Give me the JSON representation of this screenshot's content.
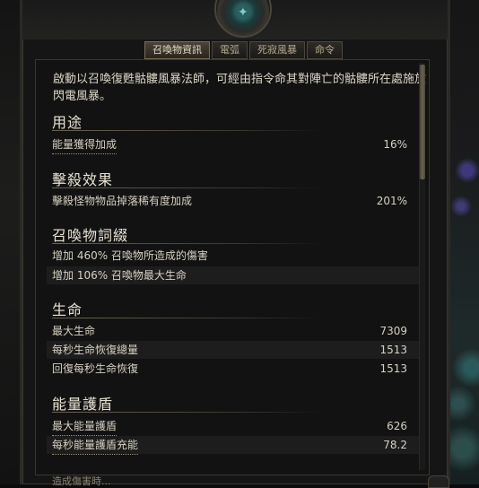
{
  "tabs": [
    "召喚物資訊",
    "電弧",
    "死寂風暴",
    "命令"
  ],
  "description": "啟動以召喚復甦骷髏風暴法師，可經由指令命其對陣亡的骷髏所在處施放閃電風暴。",
  "sections": [
    {
      "title": "用途",
      "rows": [
        {
          "label": "能量獲得加成",
          "value": "16%"
        }
      ]
    },
    {
      "title": "擊殺效果",
      "rows": [
        {
          "label": "擊殺怪物物品掉落稀有度加成",
          "value": "201%"
        }
      ]
    },
    {
      "title": "召喚物詞綴",
      "rows": [
        {
          "label": "增加 460% 召喚物所造成的傷害",
          "value": ""
        },
        {
          "label": "增加 106% 召喚物最大生命",
          "value": ""
        }
      ]
    },
    {
      "title": "生命",
      "rows": [
        {
          "label": "最大生命",
          "value": "7309"
        },
        {
          "label": "每秒生命恢復總量",
          "value": "1513"
        },
        {
          "label": "回復每秒生命恢復",
          "value": "1513"
        }
      ]
    },
    {
      "title": "能量護盾",
      "rows": [
        {
          "label": "最大能量護盾",
          "value": "626"
        },
        {
          "label": "每秒能量護盾充能",
          "value": "78.2"
        }
      ]
    }
  ],
  "bottom_text": "造成傷害時..."
}
